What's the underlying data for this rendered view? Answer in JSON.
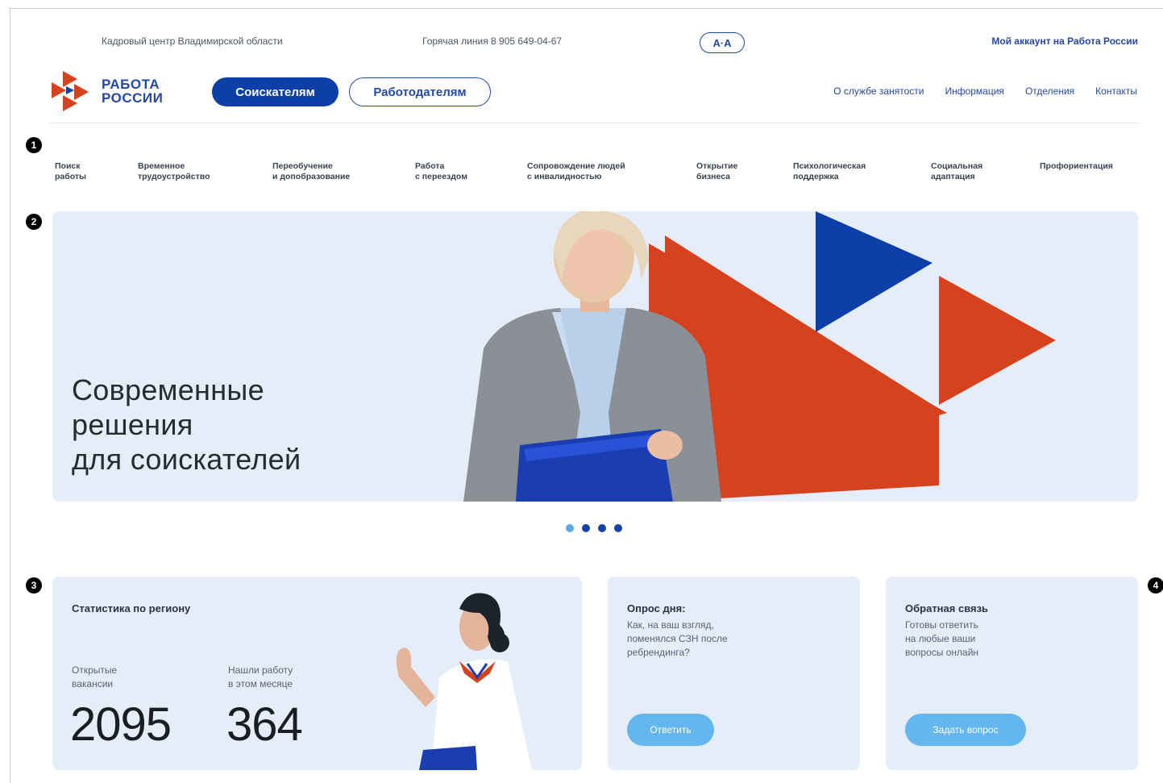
{
  "topbar": {
    "region": "Кадровый центр Владимирской области",
    "hotline": "Горячая линия 8 905 649-04-67",
    "a11y": "A·A",
    "account": "Мой аккаунт на Работа России"
  },
  "header": {
    "logo_line1": "РАБОТА",
    "logo_line2": "РОССИИ",
    "btn_seekers": "Соискателям",
    "btn_employers": "Работодателям",
    "nav": [
      "О службе занятости",
      "Информация",
      "Отделения",
      "Контакты"
    ]
  },
  "markers": [
    "1",
    "2",
    "3",
    "4"
  ],
  "categories": [
    "Поиск\nработы",
    "Временное\nтрудоустройство",
    "Переобучение\nи допобразование",
    "Работа\nс переездом",
    "Сопровождение людей\nс инвалидностью",
    "Открытие\nбизнеса",
    "Психологическая\nподдержка",
    "Социальная\nадаптация",
    "Профориентация"
  ],
  "hero": {
    "title": "Современные\nрешения\nдля соискателей",
    "slides": 4,
    "active_slide": 1
  },
  "stats": {
    "title": "Статистика по региону",
    "open_label": "Открытые\nвакансии",
    "open_value": "2095",
    "found_label": "Нашли работу\nв этом месяце",
    "found_value": "364"
  },
  "poll": {
    "title": "Опрос дня:",
    "question": "Как, на ваш взгляд,\nпоменялся СЗН после\nребрендинга?",
    "button": "Ответить"
  },
  "feedback": {
    "title": "Обратная связь",
    "text": "Готовы ответить\nна любые ваши\nвопросы онлайн",
    "button": "Задать вопрос"
  },
  "colors": {
    "brand_blue": "#0e3ea8",
    "brand_red": "#d6421e",
    "accent_light": "#64b6ee",
    "card_bg": "#e5eef8"
  }
}
